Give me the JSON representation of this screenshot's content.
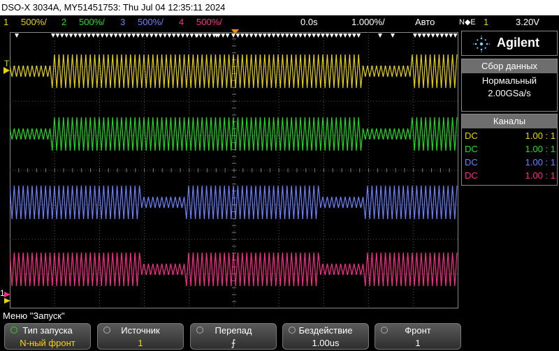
{
  "titlebar": {
    "text": "DSO-X 3034A, MY51451753: Thu Jul 04 12:35:11 2024"
  },
  "status": {
    "channels": [
      {
        "num": "1",
        "scale": "500%/",
        "color": "#e8d400"
      },
      {
        "num": "2",
        "scale": "500%/",
        "color": "#19e019"
      },
      {
        "num": "3",
        "scale": "500%/",
        "color": "#6b82ff"
      },
      {
        "num": "4",
        "scale": "500%/",
        "color": "#ff2a8a"
      }
    ],
    "delay": "0.0s",
    "timebase": "1.000%/",
    "mode": "Авто",
    "trig_type": "N◆E",
    "trig_source": "1",
    "trig_level": "3.20V"
  },
  "panel": {
    "brand": "Agilent",
    "acq_header": "Сбор данных",
    "acq_mode": "Нормальный",
    "acq_rate": "2.00GSa/s",
    "channels_header": "Каналы",
    "channels": [
      {
        "coupling": "DC",
        "ratio": "1.00 : 1",
        "color": "#e8d400"
      },
      {
        "coupling": "DC",
        "ratio": "1.00 : 1",
        "color": "#19e019"
      },
      {
        "coupling": "DC",
        "ratio": "1.00 : 1",
        "color": "#6b82ff"
      },
      {
        "coupling": "DC",
        "ratio": "1.00 : 1",
        "color": "#ff2a8a"
      }
    ]
  },
  "graticule": {
    "trigger_marker": "T",
    "ground_marker": "1"
  },
  "menu": {
    "title": "Меню \"Запуск\""
  },
  "softkeys": [
    {
      "label": "Тип запуска",
      "value": "N-ный фронт"
    },
    {
      "label": "Источник",
      "value": "1"
    },
    {
      "label": "Перепад",
      "value": "⨍"
    },
    {
      "label": "Бездействие",
      "value": "1.00us"
    },
    {
      "label": "Фронт",
      "value": "1"
    }
  ],
  "colors": {
    "grid": "#555555",
    "panel_border": "#888888"
  }
}
